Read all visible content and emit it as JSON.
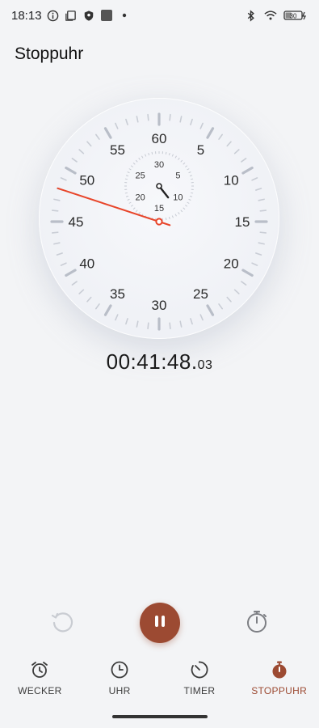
{
  "status_bar": {
    "time": "18:13",
    "battery": "30",
    "icons": [
      "info-icon",
      "copy-icon",
      "shield-icon",
      "app-square-icon",
      "dot-icon",
      "bluetooth-icon",
      "wifi-icon",
      "battery-icon"
    ]
  },
  "page": {
    "title": "Stoppuhr"
  },
  "dial": {
    "outer_labels": [
      "60",
      "5",
      "10",
      "15",
      "20",
      "25",
      "30",
      "35",
      "40",
      "45",
      "50",
      "55"
    ],
    "inner_labels": [
      "30",
      "5",
      "10",
      "15",
      "20",
      "25"
    ],
    "accent_color": "#e8452a",
    "second_hand_value": 48.03,
    "minute_hand_value": 41.8
  },
  "readout": {
    "main": "00:41:48.",
    "centis": "03"
  },
  "controls": {
    "reset_icon": "reset-icon",
    "pause_icon": "pause-icon",
    "lap_icon": "lap-stopwatch-icon",
    "pause_color": "#9c4a32"
  },
  "nav": {
    "items": [
      {
        "label": "WECKER",
        "icon": "alarm-clock-icon"
      },
      {
        "label": "UHR",
        "icon": "clock-icon"
      },
      {
        "label": "TIMER",
        "icon": "timer-icon"
      },
      {
        "label": "STOPPUHR",
        "icon": "stopwatch-icon"
      }
    ],
    "active_index": 3,
    "active_color": "#9c4a32"
  }
}
